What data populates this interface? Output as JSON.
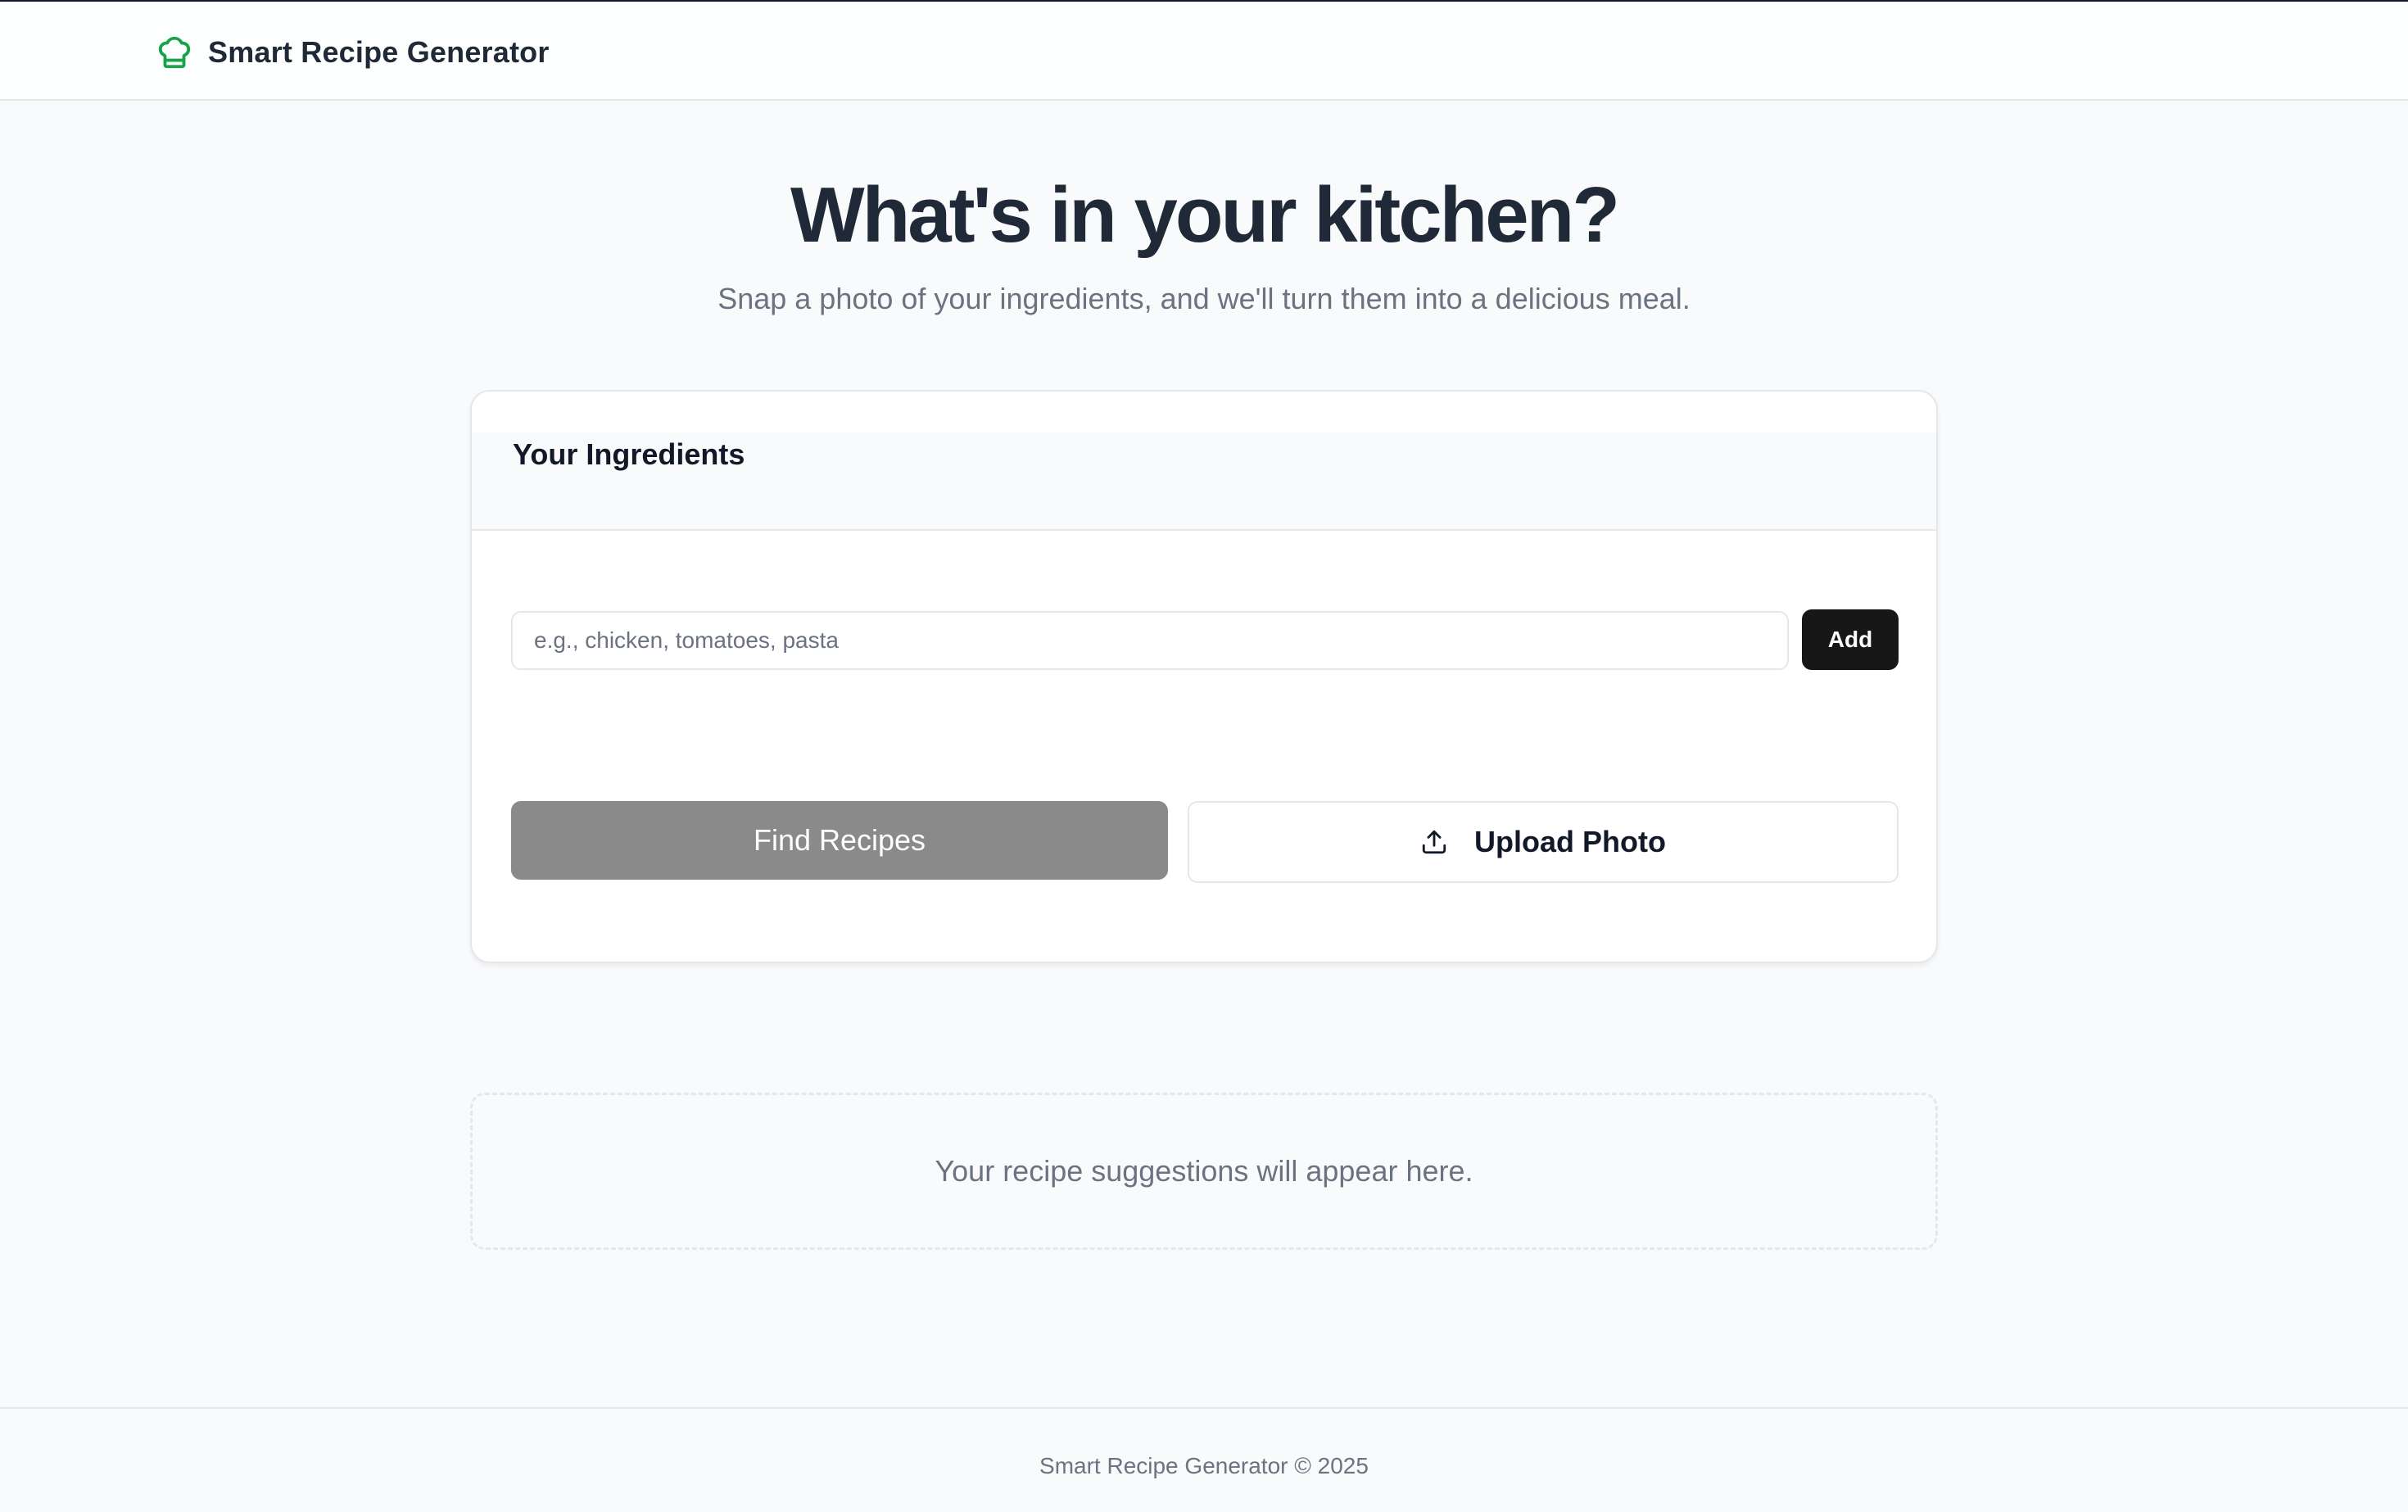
{
  "header": {
    "app_title": "Smart Recipe Generator",
    "logo_icon": "chef-hat-icon",
    "brand_color": "#16a34a"
  },
  "hero": {
    "title": "What's in your kitchen?",
    "subtitle": "Snap a photo of your ingredients, and we'll turn them into a delicious meal."
  },
  "ingredients_card": {
    "title": "Your Ingredients",
    "input": {
      "value": "",
      "placeholder": "e.g., chicken, tomatoes, pasta"
    },
    "add_label": "Add",
    "find_recipes_label": "Find Recipes",
    "upload_photo_label": "Upload Photo",
    "upload_icon": "upload-icon"
  },
  "results": {
    "placeholder_text": "Your recipe suggestions will appear here."
  },
  "footer": {
    "text": "Smart Recipe Generator © 2025"
  }
}
